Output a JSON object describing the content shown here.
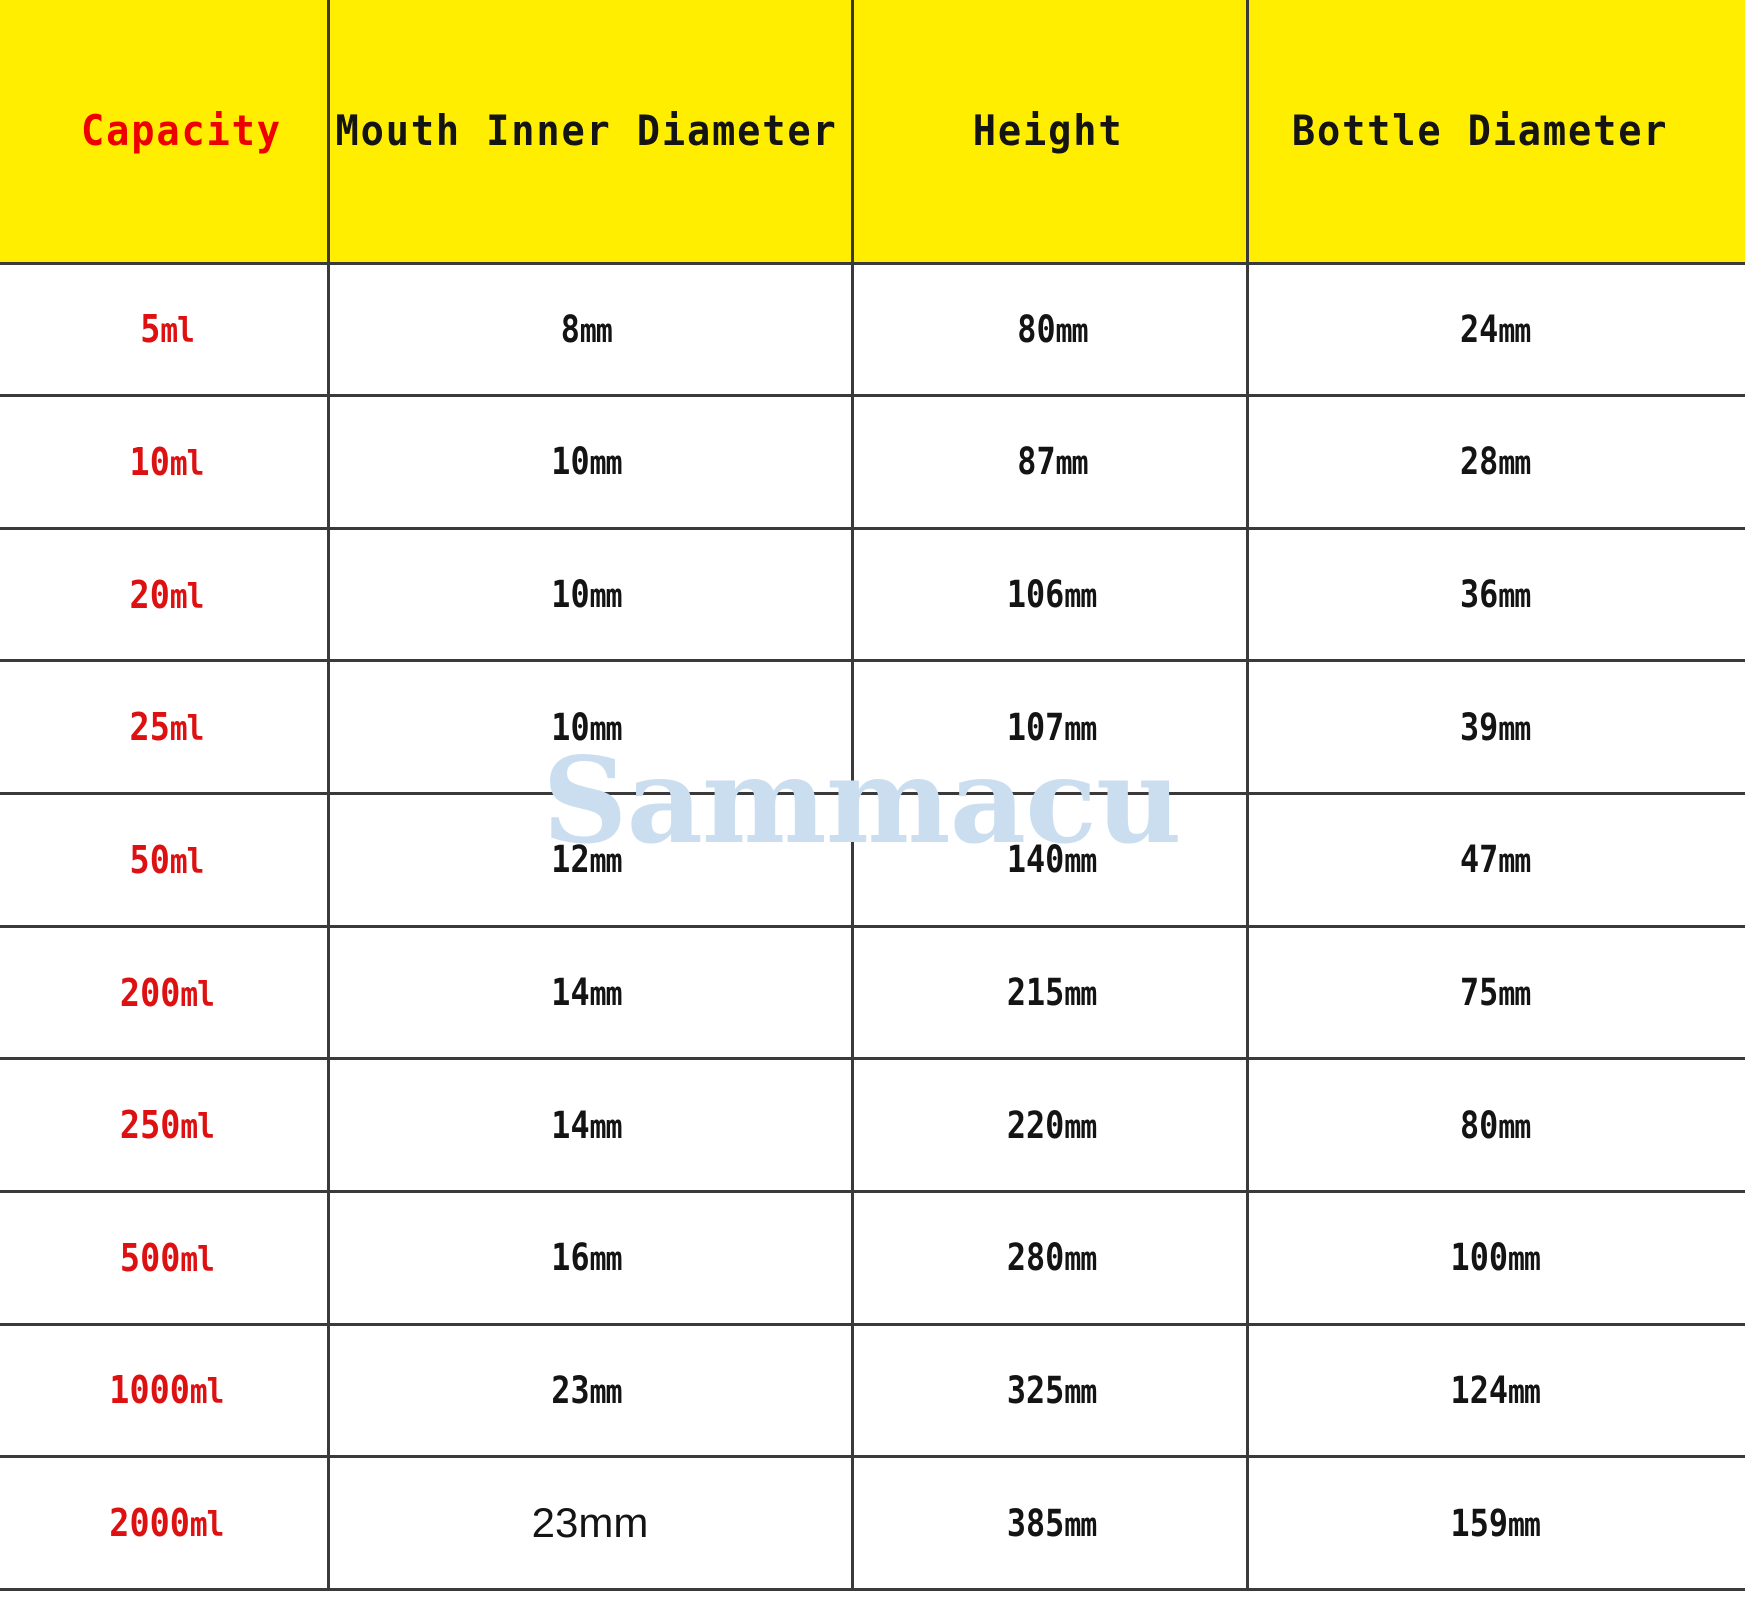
{
  "watermark": {
    "text": "Sammacu",
    "color": "#cbdef0"
  },
  "colors": {
    "header_background": "#ffee00",
    "header_accent_text": "#ee0000",
    "header_text": "#141414",
    "capacity_text": "#dd1111",
    "cell_text": "#141414",
    "border": "#3a3a3a",
    "page_background": "#ffffff"
  },
  "table": {
    "columns": [
      {
        "key": "capacity",
        "label": "Capacity"
      },
      {
        "key": "mouth",
        "label": "Mouth Inner Diameter"
      },
      {
        "key": "height",
        "label": "Height"
      },
      {
        "key": "bottle",
        "label": "Bottle Diameter"
      }
    ],
    "rows": [
      {
        "capacity": "5ml",
        "mouth": "8mm",
        "height": "80mm",
        "bottle": "24mm"
      },
      {
        "capacity": "10ml",
        "mouth": "10mm",
        "height": "87mm",
        "bottle": "28mm"
      },
      {
        "capacity": "20ml",
        "mouth": "10mm",
        "height": "106mm",
        "bottle": "36mm"
      },
      {
        "capacity": "25ml",
        "mouth": "10mm",
        "height": "107mm",
        "bottle": "39mm"
      },
      {
        "capacity": "50ml",
        "mouth": "12mm",
        "height": "140mm",
        "bottle": "47mm"
      },
      {
        "capacity": "200ml",
        "mouth": "14mm",
        "height": "215mm",
        "bottle": "75mm"
      },
      {
        "capacity": "250ml",
        "mouth": "14mm",
        "height": "220mm",
        "bottle": "80mm"
      },
      {
        "capacity": "500ml",
        "mouth": "16mm",
        "height": "280mm",
        "bottle": "100mm"
      },
      {
        "capacity": "1000ml",
        "mouth": "23mm",
        "height": "325mm",
        "bottle": "124mm"
      },
      {
        "capacity": "2000ml",
        "mouth": "23mm",
        "height": "385mm",
        "bottle": "159mm"
      }
    ]
  }
}
